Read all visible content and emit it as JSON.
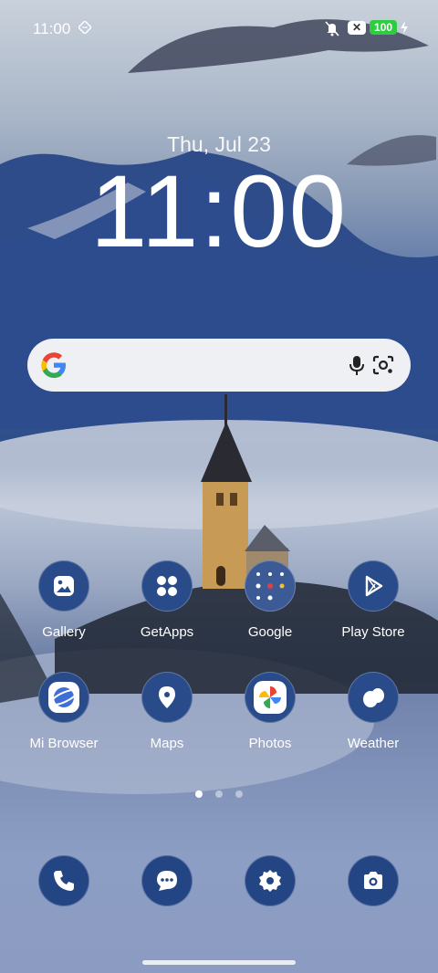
{
  "status": {
    "time": "11:00",
    "battery": "100",
    "close_badge": "✕"
  },
  "lock": {
    "date": "Thu, Jul 23",
    "clock": "11:00"
  },
  "search": {},
  "apps_row1": [
    {
      "label": "Gallery"
    },
    {
      "label": "GetApps"
    },
    {
      "label": "Google"
    },
    {
      "label": "Play Store"
    }
  ],
  "apps_row2": [
    {
      "label": "Mi Browser"
    },
    {
      "label": "Maps"
    },
    {
      "label": "Photos"
    },
    {
      "label": "Weather"
    }
  ],
  "pages": {
    "count": 3,
    "active": 1
  },
  "dock": [
    "phone-icon",
    "messages-icon",
    "settings-icon",
    "camera-icon"
  ]
}
